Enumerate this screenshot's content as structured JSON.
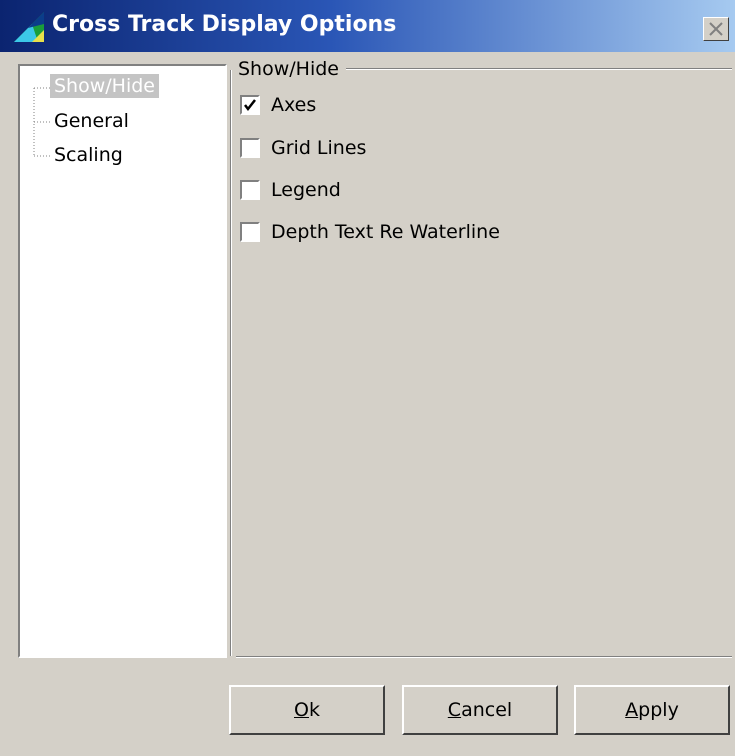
{
  "window": {
    "title": "Cross Track Display Options",
    "close_symbol": "×",
    "icon": "app-icon"
  },
  "tree": {
    "items": [
      {
        "label": "Show/Hide",
        "selected": true
      },
      {
        "label": "General",
        "selected": false
      },
      {
        "label": "Scaling",
        "selected": false
      }
    ]
  },
  "group": {
    "title": "Show/Hide",
    "checkboxes": [
      {
        "label": "Axes",
        "checked": true
      },
      {
        "label": "Grid Lines",
        "checked": false
      },
      {
        "label": "Legend",
        "checked": false
      },
      {
        "label": "Depth Text Re Waterline",
        "checked": false
      }
    ]
  },
  "buttons": {
    "ok": {
      "mnemonic": "O",
      "rest": "k"
    },
    "cancel": {
      "mnemonic": "C",
      "rest": "ancel"
    },
    "apply": {
      "mnemonic": "A",
      "rest": "pply"
    }
  }
}
